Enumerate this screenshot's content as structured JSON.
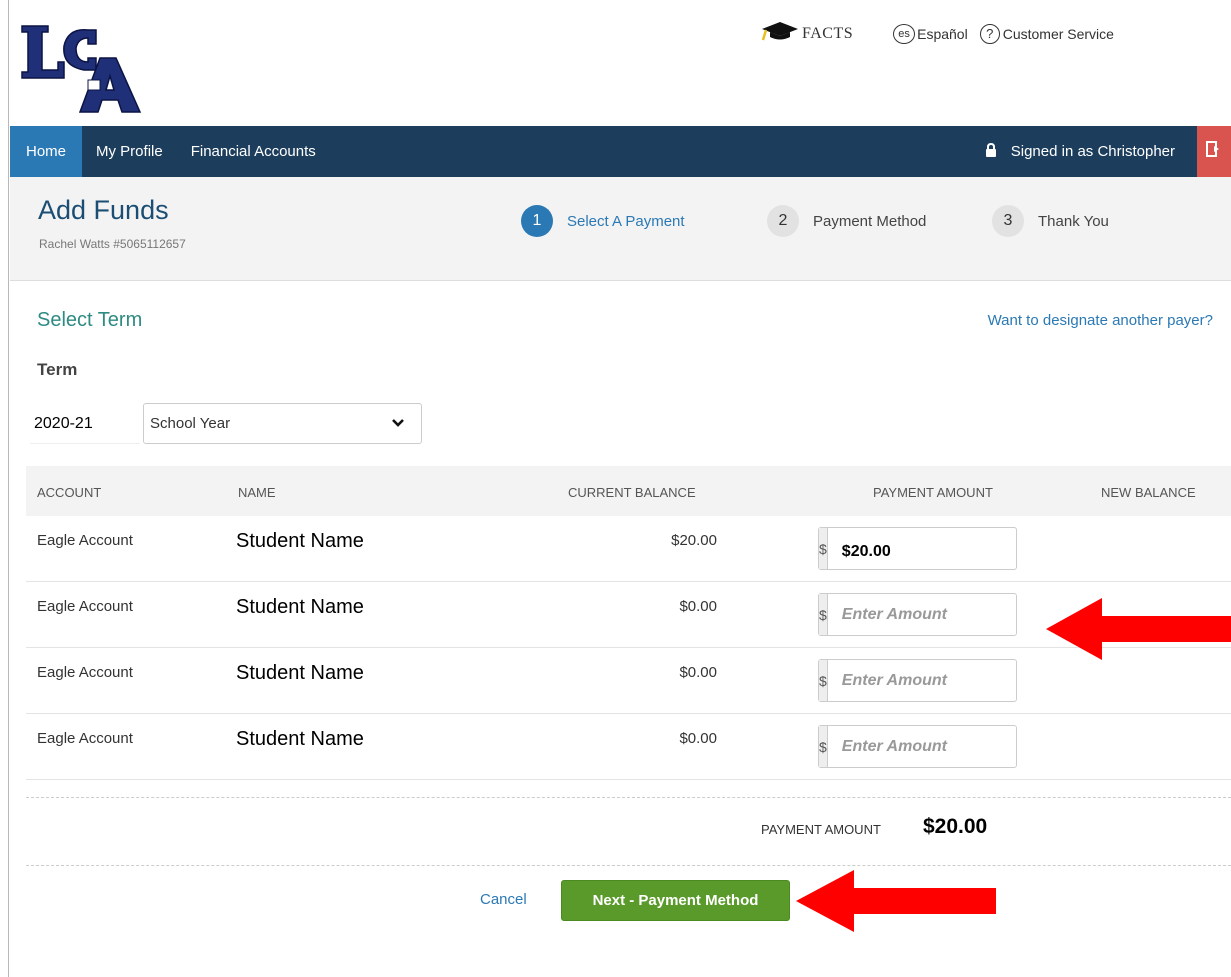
{
  "header": {
    "logo_text": "LCA",
    "facts_label": "FACTS",
    "espanol_badge": "es",
    "espanol_label": "Español",
    "customer_service_badge": "?",
    "customer_service_label": "Customer Service"
  },
  "nav": {
    "items": [
      {
        "label": "Home",
        "active": true
      },
      {
        "label": "My Profile",
        "active": false
      },
      {
        "label": "Financial Accounts",
        "active": false
      }
    ],
    "signed_in": "Signed in as Christopher"
  },
  "page": {
    "title": "Add Funds",
    "subtitle": "Rachel Watts #5065112657"
  },
  "steps": [
    {
      "number": "1",
      "label": "Select A Payment",
      "active": true
    },
    {
      "number": "2",
      "label": "Payment Method",
      "active": false
    },
    {
      "number": "3",
      "label": "Thank You",
      "active": false
    }
  ],
  "term_section": {
    "title": "Select Term",
    "designate_link": "Want to designate another payer?",
    "term_label": "Term",
    "term_year": "2020-21",
    "term_selected": "School Year"
  },
  "table": {
    "headers": [
      "ACCOUNT",
      "NAME",
      "CURRENT BALANCE",
      "PAYMENT AMOUNT",
      "NEW BALANCE"
    ],
    "currency_symbol": "$",
    "rows": [
      {
        "account": "Eagle Account",
        "name": "Student Name",
        "balance": "$20.00",
        "amount": "$20.00",
        "placeholder": "Enter Amount"
      },
      {
        "account": "Eagle Account",
        "name": "Student Name",
        "balance": "$0.00",
        "amount": "",
        "placeholder": "Enter Amount"
      },
      {
        "account": "Eagle Account",
        "name": "Student Name",
        "balance": "$0.00",
        "amount": "",
        "placeholder": "Enter Amount"
      },
      {
        "account": "Eagle Account",
        "name": "Student Name",
        "balance": "$0.00",
        "amount": "",
        "placeholder": "Enter Amount"
      }
    ]
  },
  "totals": {
    "label": "PAYMENT AMOUNT",
    "value": "$20.00"
  },
  "actions": {
    "cancel": "Cancel",
    "next": "Next - Payment Method"
  },
  "colors": {
    "nav_bg": "#1c3d5c",
    "nav_active": "#2b79b4",
    "primary_button": "#5a9a2a",
    "signout": "#d9534f",
    "annotation_arrow": "#ff0000"
  }
}
